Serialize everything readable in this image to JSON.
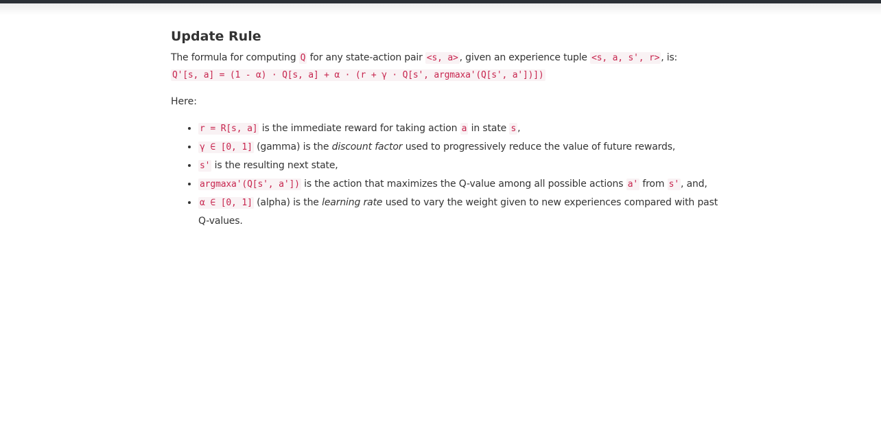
{
  "heading": "Update Rule",
  "intro": {
    "t1": "The formula for computing ",
    "c1": "Q",
    "t2": " for any state-action pair ",
    "c2": "<s, a>",
    "t3": ", given an experience tuple ",
    "c3": "<s, a, s', r>",
    "t4": ", is:",
    "formula": "Q'[s, a] = (1 - α) · Q[s, a] + α · (r + γ · Q[s', argmaxa'(Q[s', a'])])"
  },
  "here": "Here:",
  "bullets": [
    {
      "c1": "r = R[s, a]",
      "t1": " is the immediate reward for taking action ",
      "c2": "a",
      "t2": " in state ",
      "c3": "s",
      "t3": ","
    },
    {
      "c1": "γ ∈ [0, 1]",
      "t1": " (gamma) is the ",
      "em": "discount factor",
      "t2": " used to progressively reduce the value of future rewards,"
    },
    {
      "c1": "s'",
      "t1": " is the resulting next state,"
    },
    {
      "c1": "argmaxa'(Q[s', a'])",
      "t1": " is the action that maximizes the Q-value among all possible actions ",
      "c2": "a'",
      "t2": " from ",
      "c3": "s'",
      "t3": ", and,"
    },
    {
      "c1": "α ∈ [0, 1]",
      "t1": " (alpha) is the ",
      "em": "learning rate",
      "t2": " used to vary the weight given to new experiences compared with past Q-values."
    }
  ],
  "colors": {
    "code_text": "#c7254e",
    "code_bg": "#f9f2f4",
    "body_text": "#333333",
    "top_bar": "#2b3036"
  }
}
